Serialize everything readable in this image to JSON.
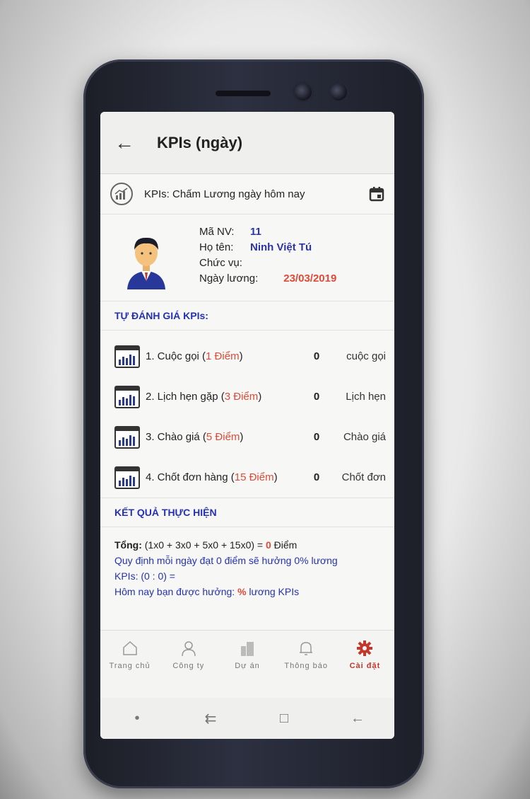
{
  "header": {
    "title": "KPIs (ngày)"
  },
  "section": {
    "title": "KPIs: Chấm Lương ngày hôm nay"
  },
  "employee": {
    "id_label": "Mã NV:",
    "id_value": "11",
    "name_label": "Họ tên:",
    "name_value": "Ninh Việt Tú",
    "position_label": "Chức vụ:",
    "position_value": "",
    "date_label": "Ngày lương:",
    "date_value": "23/03/2019"
  },
  "self_eval": {
    "title": "TỰ ĐÁNH GIÁ KPIs:",
    "items": [
      {
        "prefix": "1. Cuộc gọi (",
        "points": "1 Điểm",
        "suffix": ")",
        "count": "0",
        "unit": "cuộc gọi"
      },
      {
        "prefix": "2. Lịch hẹn gặp (",
        "points": "3 Điểm",
        "suffix": ")",
        "count": "0",
        "unit": "Lịch hẹn"
      },
      {
        "prefix": "3. Chào giá (",
        "points": "5 Điểm",
        "suffix": ")",
        "count": "0",
        "unit": "Chào giá"
      },
      {
        "prefix": "4. Chốt đơn hàng (",
        "points": "15 Điểm",
        "suffix": ")",
        "count": "0",
        "unit": "Chốt đơn"
      }
    ]
  },
  "result": {
    "title": "KẾT QUẢ THỰC HIỆN",
    "total_label": "Tổng:",
    "total_formula": " (1x0 + 3x0 + 5x0 + 15x0) = ",
    "total_value": "0",
    "total_unit": "  Điểm",
    "rule": "Quy định mỗi ngày đạt 0 điểm sẽ hưởng 0% lương",
    "kpi_ratio": "KPIs: (0 : 0) =",
    "today_prefix": "Hôm nay bạn được hưởng: ",
    "today_pct": "%",
    "today_suffix": " lương KPIs"
  },
  "nav": {
    "items": [
      {
        "label": "Trang chủ",
        "icon": "home-icon"
      },
      {
        "label": "Công ty",
        "icon": "user-icon"
      },
      {
        "label": "Dự án",
        "icon": "building-icon"
      },
      {
        "label": "Thông báo",
        "icon": "bell-icon"
      },
      {
        "label": "Cài đặt",
        "icon": "gear-icon",
        "active": true
      }
    ]
  },
  "colors": {
    "accent_blue": "#2432b4",
    "accent_red": "#e04a36",
    "active_nav": "#c0392b"
  }
}
